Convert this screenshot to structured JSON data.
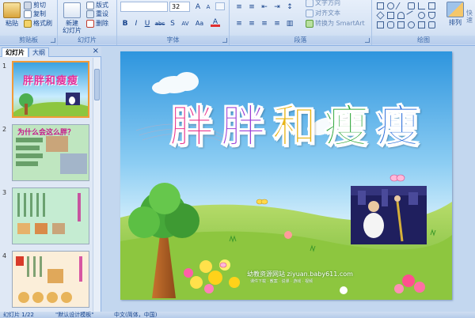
{
  "ribbon": {
    "clipboard": {
      "label": "剪贴板",
      "paste": "粘贴",
      "cut": "剪切",
      "copy": "复制",
      "format_painter": "格式刷"
    },
    "slides": {
      "label": "幻灯片",
      "new_slide": "新建",
      "new_slide_line2": "幻灯片",
      "layout": "版式",
      "reset": "重设",
      "delete": "删除"
    },
    "font": {
      "label": "字体",
      "font_size": "32",
      "bold": "B",
      "italic": "I",
      "underline": "U",
      "strike": "abc",
      "shadow": "S",
      "char_spacing": "AV",
      "change_case": "Aa",
      "font_color": "A",
      "grow": "A",
      "shrink": "A"
    },
    "paragraph": {
      "label": "段落",
      "text_direction": "文字方向",
      "align_text": "对齐文本",
      "smartart": "转换为 SmartArt"
    },
    "drawing": {
      "label": "绘图",
      "arrange": "排列",
      "quick_styles": "快速"
    }
  },
  "panel": {
    "tab_slides": "幻灯片",
    "tab_outline": "大纲",
    "close": "×",
    "thumbs": [
      {
        "num": "1",
        "title": "胖胖和瘦瘦"
      },
      {
        "num": "2",
        "title": "为什么会这么胖？"
      },
      {
        "num": "3",
        "title": ""
      },
      {
        "num": "4",
        "title": ""
      }
    ]
  },
  "slide": {
    "title_chars": [
      "胖",
      "胖",
      "和",
      "瘦",
      "瘦"
    ],
    "watermark": "幼教资源网站 ziyuan.baby611.com",
    "watermark_small": "课件下载 · 教案 · 说课 · 游戏 · 视频"
  },
  "status": {
    "page": "幻灯片 1/22",
    "theme": "\"默认设计模板\"",
    "lang": "中文(简体，中国)"
  },
  "colors": {
    "ribbon_bg": "#d4e2f4",
    "selection": "#f29b38",
    "sky_top": "#3aa1e0",
    "grass": "#8dc63f"
  }
}
